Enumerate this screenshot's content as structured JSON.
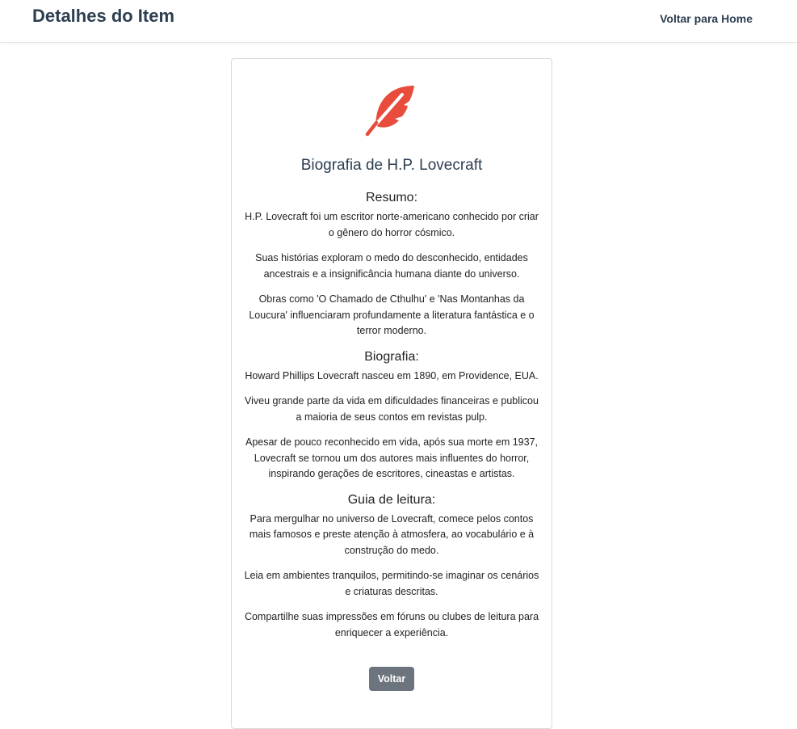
{
  "header": {
    "title": "Detalhes do Item",
    "home_link": "Voltar para Home"
  },
  "item": {
    "icon": "feather-icon",
    "icon_color": "#e74c3c",
    "title": "Biografia de H.P. Lovecraft",
    "sections": [
      {
        "heading": "Resumo:",
        "paragraphs": [
          "H.P. Lovecraft foi um escritor norte-americano conhecido por criar o gênero do horror cósmico.",
          "Suas histórias exploram o medo do desconhecido, entidades ancestrais e a insignificância humana diante do universo.",
          "Obras como 'O Chamado de Cthulhu' e 'Nas Montanhas da Loucura' influenciaram profundamente a literatura fantástica e o terror moderno."
        ]
      },
      {
        "heading": "Biografia:",
        "paragraphs": [
          "Howard Phillips Lovecraft nasceu em 1890, em Providence, EUA.",
          "Viveu grande parte da vida em dificuldades financeiras e publicou a maioria de seus contos em revistas pulp.",
          "Apesar de pouco reconhecido em vida, após sua morte em 1937, Lovecraft se tornou um dos autores mais influentes do horror, inspirando gerações de escritores, cineastas e artistas."
        ]
      },
      {
        "heading": "Guia de leitura:",
        "paragraphs": [
          "Para mergulhar no universo de Lovecraft, comece pelos contos mais famosos e preste atenção à atmosfera, ao vocabulário e à construção do medo.",
          "Leia em ambientes tranquilos, permitindo-se imaginar os cenários e criaturas descritas.",
          "Compartilhe suas impressões em fóruns ou clubes de leitura para enriquecer a experiência."
        ]
      }
    ],
    "back_button": "Voltar"
  }
}
